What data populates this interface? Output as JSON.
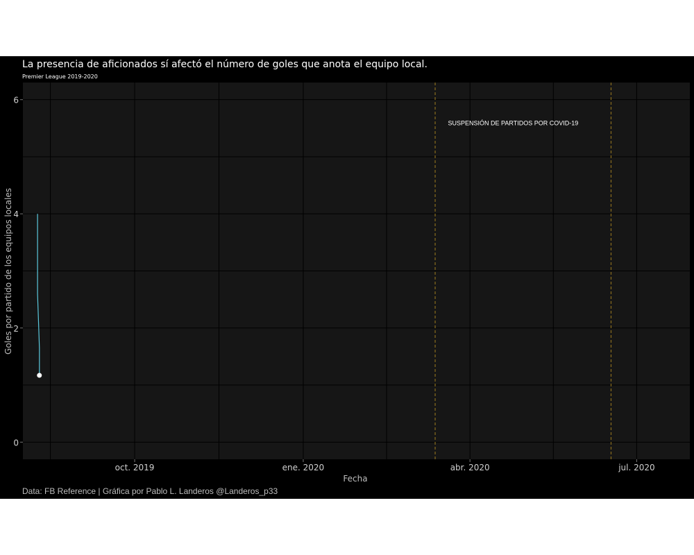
{
  "chart_data": {
    "type": "line",
    "title": "La presencia de aficionados sí afectó el número de goles que anota el equipo local.",
    "subtitle": "Premier League 2019-2020",
    "xlabel": "Fecha",
    "ylabel": "Goles por partido de los equipos locales",
    "caption": "Data: FB Reference | Gráfica por Pablo L. Landeros @Landeros_p33",
    "x_range": [
      "2019-08-01",
      "2020-07-30"
    ],
    "ylim": [
      -0.3,
      6.3
    ],
    "x_ticks": [
      {
        "date": "2019-10-01",
        "label": "oct. 2019"
      },
      {
        "date": "2020-01-01",
        "label": "ene. 2020"
      },
      {
        "date": "2020-04-01",
        "label": "abr. 2020"
      },
      {
        "date": "2020-07-01",
        "label": "jul. 2020"
      }
    ],
    "y_ticks": [
      0,
      2,
      4,
      6
    ],
    "grid": true,
    "series": [
      {
        "color": "#5bc8dc",
        "points": [
          {
            "x": "2019-08-09",
            "y": 4.0
          },
          {
            "x": "2019-08-09",
            "y": 3.5
          },
          {
            "x": "2019-08-09",
            "y": 2.6
          },
          {
            "x": "2019-08-10",
            "y": 1.65
          },
          {
            "x": "2019-08-10",
            "y": 1.17
          }
        ],
        "end_marker": {
          "x": "2019-08-10",
          "y": 1.17,
          "color": "#ffffff"
        }
      }
    ],
    "reference_lines": [
      {
        "x": "2020-03-13",
        "color": "#8a6d1e"
      },
      {
        "x": "2020-06-17",
        "color": "#8a6d1e"
      }
    ],
    "annotation": {
      "text": "SUSPENSIÓN DE PARTIDOS POR COVID-19",
      "x": "2020-03-20",
      "y": 5.55
    },
    "colors": {
      "background": "#000000",
      "panel": "#161616",
      "grid": "#000000",
      "text": "#ffffff",
      "axis_text": "#cfcfcf"
    }
  }
}
